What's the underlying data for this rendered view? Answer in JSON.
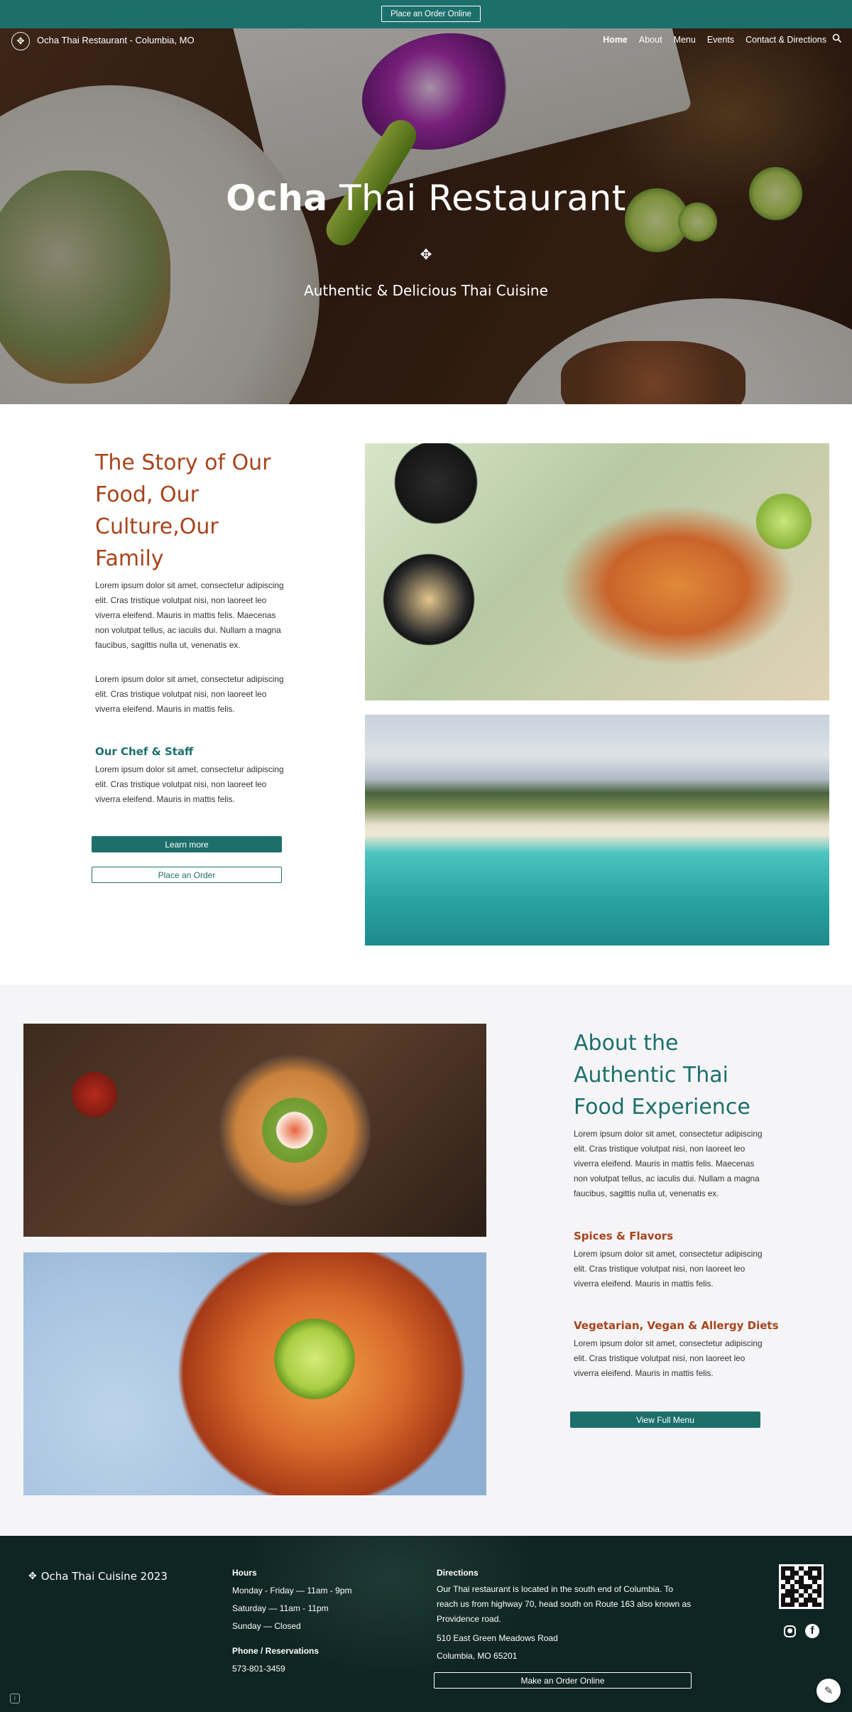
{
  "order_bar": {
    "button_label": "Place an Order Online"
  },
  "nav": {
    "site_title": "Ocha Thai Restaurant - Columbia, MO",
    "links": [
      "Home",
      "About",
      "Menu",
      "Events",
      "Contact & Directions"
    ],
    "active": "Home",
    "search_icon": "search-icon",
    "logo_icon": "ornament-icon"
  },
  "hero": {
    "title_bold": "Ocha",
    "title_light": "Thai Restaurant",
    "subtitle": "Authentic & Delicious Thai Cuisine",
    "ornament_icon": "ornament-icon",
    "scroll_icon": "chevron-down-icon"
  },
  "story": {
    "heading": "The Story of Our Food, Our Culture,Our Family",
    "paragraph1": "Lorem ipsum dolor sit amet, consectetur adipiscing elit. Cras tristique volutpat nisi, non laoreet leo viverra eleifend. Mauris in mattis felis. Maecenas non volutpat tellus, ac iaculis dui. Nullam a magna faucibus, sagittis nulla ut, venenatis ex.",
    "paragraph2": "Lorem ipsum dolor sit amet, consectetur adipiscing elit. Cras tristique volutpat nisi, non laoreet leo viverra eleifend. Mauris in mattis felis.",
    "subheading": "Our Chef & Staff",
    "paragraph3": "Lorem ipsum dolor sit amet, consectetur adipiscing elit. Cras tristique volutpat nisi, non laoreet leo viverra eleifend. Mauris in mattis felis.",
    "learn_more": "Learn more",
    "place_order": "Place an Order"
  },
  "about": {
    "heading": "About the Authentic Thai Food Experience",
    "paragraph1": "Lorem ipsum dolor sit amet, consectetur adipiscing elit. Cras tristique volutpat nisi, non laoreet leo viverra eleifend. Mauris in mattis felis. Maecenas non volutpat tellus, ac iaculis dui. Nullam a magna faucibus, sagittis nulla ut, venenatis ex.",
    "sub1": "Spices & Flavors",
    "paragraph2": "Lorem ipsum dolor sit amet, consectetur adipiscing elit. Cras tristique volutpat nisi, non laoreet leo viverra eleifend. Mauris in mattis felis.",
    "sub2": "Vegetarian, Vegan & Allergy Diets",
    "paragraph3": "Lorem ipsum dolor sit amet, consectetur adipiscing elit. Cras tristique volutpat nisi, non laoreet leo viverra eleifend. Mauris in mattis felis.",
    "menu_button": "View Full Menu"
  },
  "footer": {
    "brand": "Ocha Thai Cuisine 2023",
    "hours_heading": "Hours",
    "hours": [
      "Monday - Friday  —  11am - 9pm",
      "Saturday  —  11am - 11pm",
      "Sunday  —  Closed"
    ],
    "phone_heading": "Phone / Reservations",
    "phone": "573-801-3459",
    "directions_heading": "Directions",
    "directions_text": "Our Thai restaurant is located in the south end of Columbia. To reach us from highway 70, head south on Route 163 also known as Providence road.",
    "address_line1": "510 East Green Meadows Road",
    "address_line2": "Columbia, MO 65201",
    "order_button": "Make an Order Online",
    "instagram_icon": "instagram-icon",
    "facebook_icon": "facebook-icon"
  },
  "colors": {
    "teal": "#1d6f6c",
    "rust": "#a8441c",
    "footer_bg": "#0f2523",
    "section_gray": "#f5f5f7"
  }
}
